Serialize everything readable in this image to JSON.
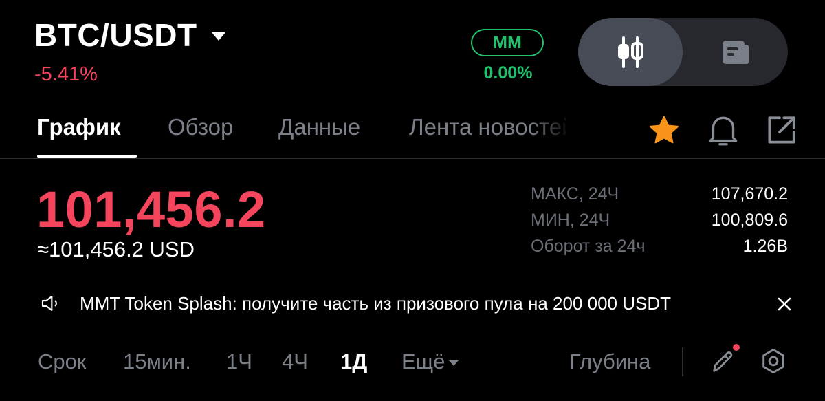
{
  "header": {
    "pair": "BTC/USDT",
    "change": "-5.41%",
    "mm_label": "MM",
    "mm_value": "0.00%"
  },
  "tabs": [
    {
      "label": "График",
      "active": true
    },
    {
      "label": "Обзор",
      "active": false
    },
    {
      "label": "Данные",
      "active": false
    },
    {
      "label": "Лента новостей",
      "active": false
    }
  ],
  "icons": {
    "favorite": "star-icon",
    "alerts": "bell-icon",
    "share": "share-icon",
    "chart_view": "candlestick-icon",
    "info_view": "news-icon",
    "sound": "speaker-icon",
    "close": "close-icon",
    "draw": "pencil-icon",
    "settings": "settings-icon"
  },
  "price": {
    "last": "101,456.2",
    "usd": "≈101,456.2 USD"
  },
  "stats": [
    {
      "label": "МАКС, 24Ч",
      "value": "107,670.2"
    },
    {
      "label": "МИН, 24Ч",
      "value": "100,809.6"
    },
    {
      "label": "Оборот за 24ч",
      "value": "1.26B"
    }
  ],
  "announcement": {
    "text": "MMT Token Splash: получите часть из призового пула на 200 000 USDT"
  },
  "timeframes": {
    "label": "Срок",
    "items": [
      {
        "label": "15мин.",
        "active": false
      },
      {
        "label": "1Ч",
        "active": false
      },
      {
        "label": "4Ч",
        "active": false
      },
      {
        "label": "1Д",
        "active": true
      }
    ],
    "more": "Ещё",
    "depth": "Глубина"
  },
  "colors": {
    "down": "#f5455c",
    "up": "#21c26e",
    "favorite": "#f7931a",
    "muted": "#7b7f88"
  }
}
